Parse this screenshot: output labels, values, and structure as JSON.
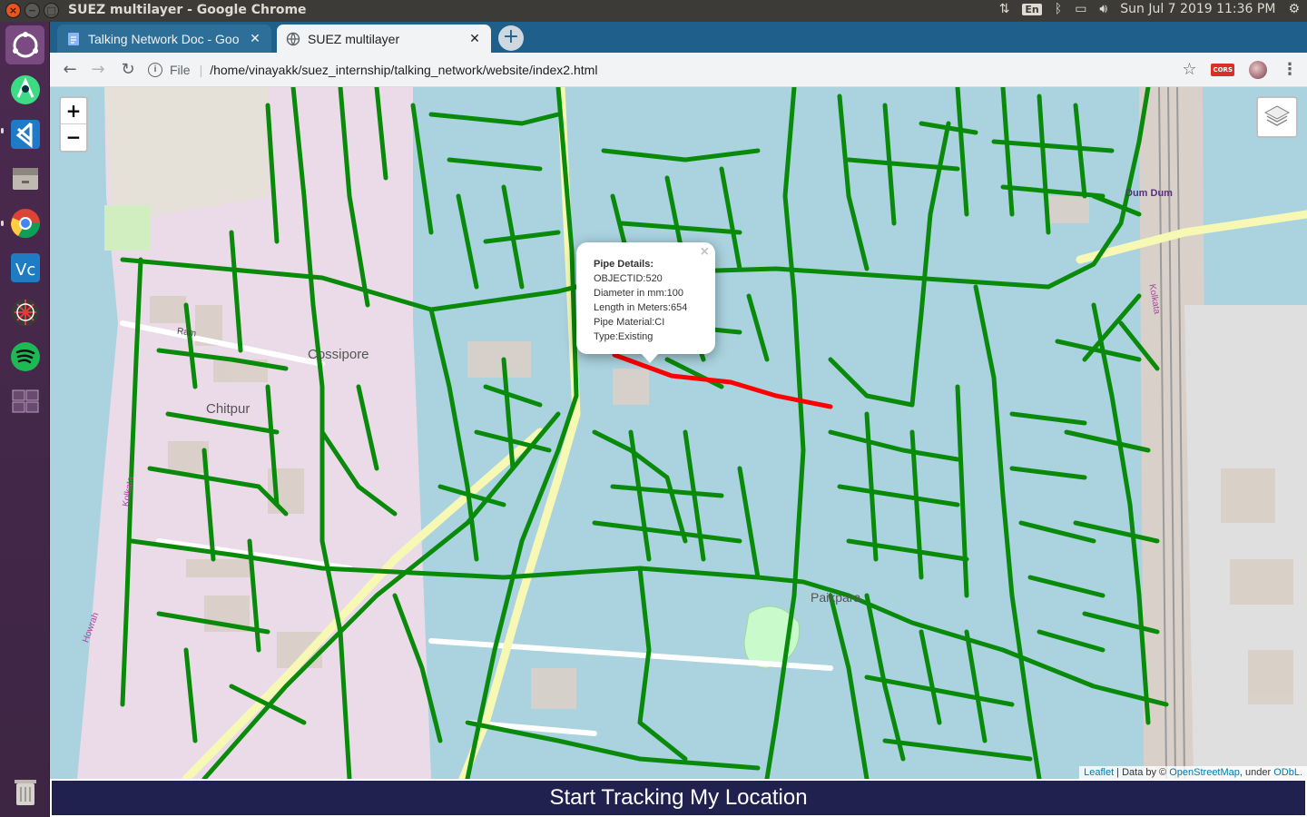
{
  "os": {
    "window_title": "SUEZ multilayer - Google Chrome",
    "keyboard_layout": "En",
    "clock": "Sun Jul  7 2019 11:36 PM",
    "launcher_icons": [
      "ubuntu-dash-icon",
      "android-studio-icon",
      "vscode-icon",
      "files-icon",
      "chrome-icon",
      "vnc-viewer-icon",
      "network-tool-icon",
      "spotify-icon",
      "workspace-switcher-icon",
      "trash-icon"
    ]
  },
  "browser": {
    "tabs": [
      {
        "label": "Talking Network Doc - Goo",
        "icon": "docs-icon",
        "active": false
      },
      {
        "label": "SUEZ multilayer",
        "icon": "globe-icon",
        "active": true
      }
    ],
    "address": {
      "scheme_label": "File",
      "path": "/home/vinayakk/suez_internship/talking_network/website/index2.html"
    },
    "extension_badge": "CORS"
  },
  "map": {
    "zoom_in": "+",
    "zoom_out": "−",
    "labels": {
      "cossipore": "Cossipore",
      "chitpur": "Chitpur",
      "paikpara": "Paikpara",
      "dum_dum": "Dum Dum",
      "kolkata_left": "Kolkata",
      "kolkata_right": "Kolkata",
      "howrah": "Howrah",
      "ram_road": "Ram"
    },
    "popup": {
      "title": "Pipe Details:",
      "object_id": "OBJECTID:520",
      "diameter": "Diameter in mm:100",
      "length": "Length in Meters:654",
      "material": "Pipe Material:CI",
      "type": "Type:Existing",
      "close": "×"
    },
    "attribution": {
      "leaflet": "Leaflet",
      "sep": " | Data by © ",
      "osm": "OpenStreetMap",
      "under": ", under ",
      "odbl": "ODbL."
    },
    "colors": {
      "water": "#aad3df",
      "pipe": "#0a8a0a",
      "selected_pipe": "#ff0000",
      "land_industrial": "#ebdbe8",
      "residential": "#e0dfdf"
    }
  },
  "track_button": "Start Tracking My Location"
}
